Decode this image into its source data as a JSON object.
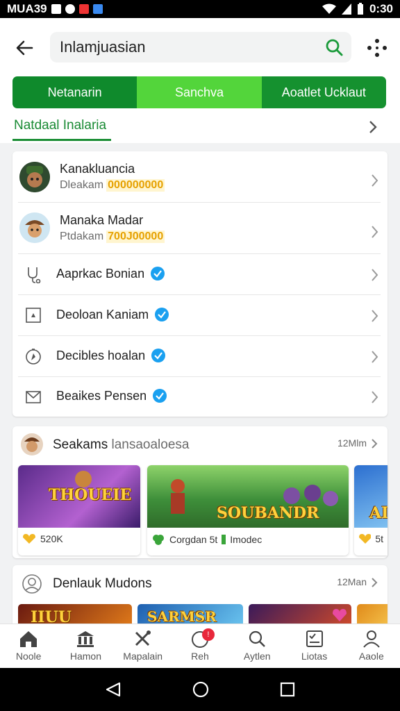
{
  "status_bar": {
    "carrier": "MUA39",
    "time": "0:30"
  },
  "search": {
    "value": "Inlamjuasian"
  },
  "segments": [
    "Netanarin",
    "Sanchva",
    "Aoatlet Ucklaut"
  ],
  "subtab": {
    "label": "Natdaal Inalaria"
  },
  "profiles": [
    {
      "name": "Kanakluancia",
      "sub_label": "Dleakam",
      "sub_value": "000000000"
    },
    {
      "name": "Manaka Madar",
      "sub_label": "Ptdakam",
      "sub_value": "700J00000"
    }
  ],
  "menu_items": [
    {
      "label": "Aaprkac Bonian",
      "icon": "stethoscope-icon"
    },
    {
      "label": "Deoloan Kaniam",
      "icon": "frame-icon"
    },
    {
      "label": "Decibles hoalan",
      "icon": "compass-icon"
    },
    {
      "label": "Beaikes Pensen",
      "icon": "mail-icon"
    }
  ],
  "section1": {
    "title_main": "Seakams",
    "title_light": "lansaoaloesa",
    "more": "12Mlm",
    "games": [
      {
        "art_text": "THOUEIE",
        "meta": "520K"
      },
      {
        "art_text": "SOUBANDR",
        "meta_a": "Corgdan 5t",
        "meta_b": "Imodec"
      },
      {
        "art_text": "AI",
        "meta": "5t"
      }
    ]
  },
  "section2": {
    "title": "Denlauk Mudons",
    "more": "12Man",
    "thumb_texts": [
      "IIUU",
      "SARMSR",
      ""
    ]
  },
  "bottom_nav": [
    {
      "label": "Noole",
      "icon": "home-icon"
    },
    {
      "label": "Hamon",
      "icon": "bank-icon"
    },
    {
      "label": "Mapalain",
      "icon": "tools-icon"
    },
    {
      "label": "Reh",
      "icon": "alert-icon",
      "badge": "!"
    },
    {
      "label": "Aytlen",
      "icon": "search-icon"
    },
    {
      "label": "Liotas",
      "icon": "checklist-icon"
    },
    {
      "label": "Aaole",
      "icon": "person-icon"
    }
  ],
  "colors": {
    "accent_green": "#0f8a2c",
    "light_green": "#53d53b",
    "gold": "#e6a100",
    "verified_blue": "#1aa0f0"
  }
}
